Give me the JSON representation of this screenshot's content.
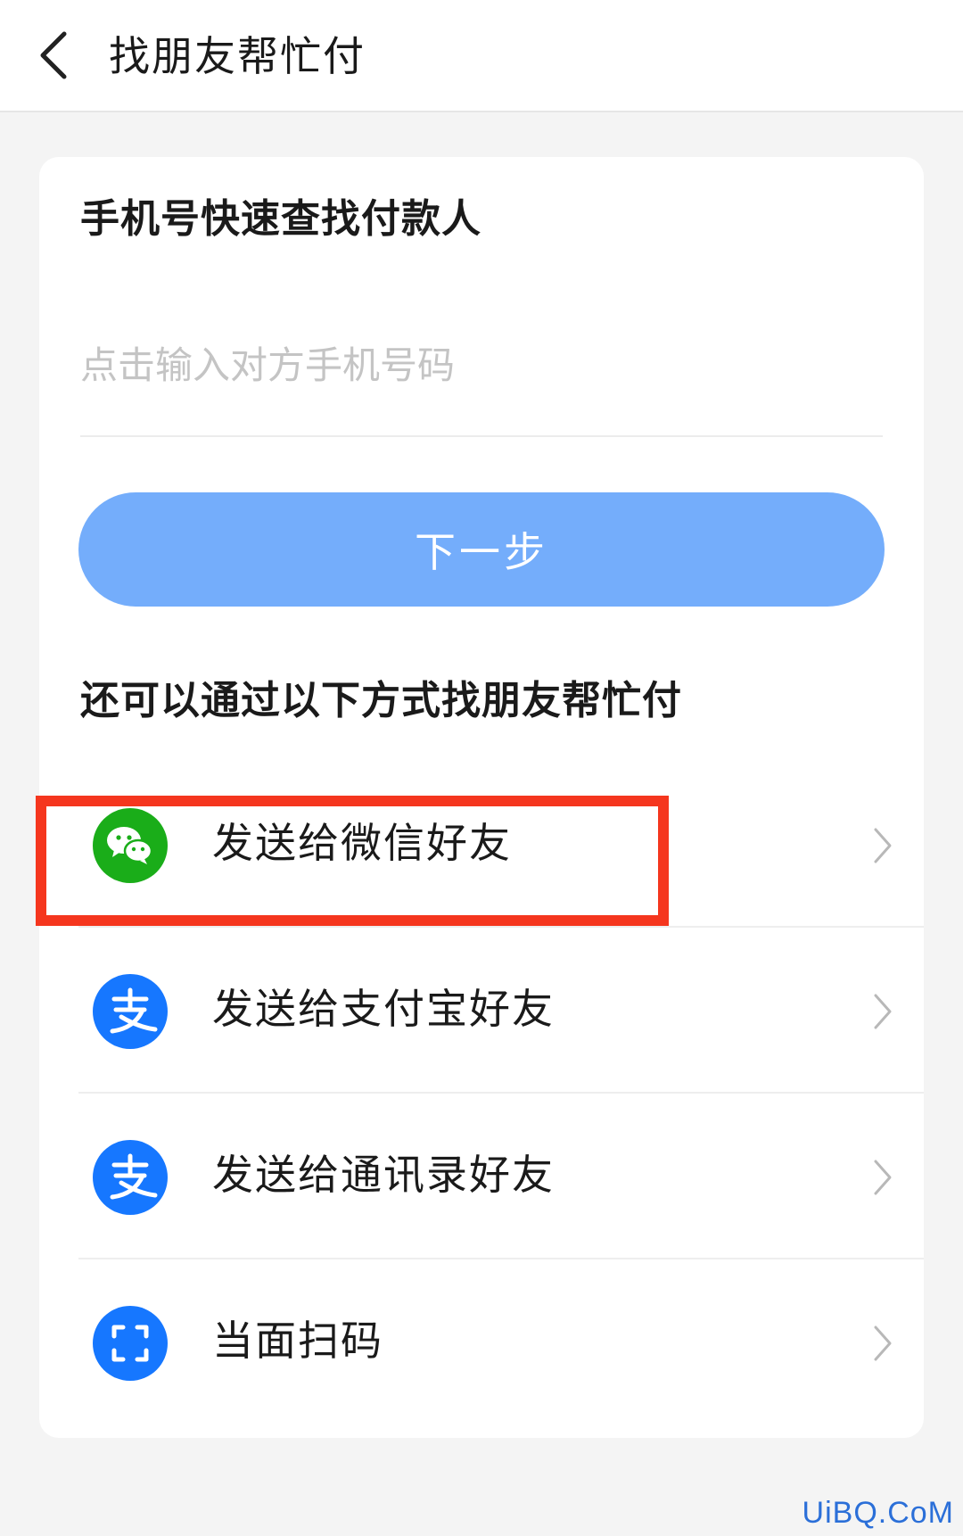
{
  "header": {
    "title": "找朋友帮忙付"
  },
  "phone_section": {
    "title": "手机号快速查找付款人",
    "input_placeholder": "点击输入对方手机号码",
    "input_value": "",
    "next_label": "下一步"
  },
  "alt_section": {
    "title": "还可以通过以下方式找朋友帮忙付",
    "options": [
      {
        "label": "发送给微信好友",
        "icon": "wechat-icon",
        "color": "#1aad19"
      },
      {
        "label": "发送给支付宝好友",
        "icon": "alipay-icon",
        "color": "#1677ff"
      },
      {
        "label": "发送给通讯录好友",
        "icon": "alipay-icon",
        "color": "#1677ff"
      },
      {
        "label": "当面扫码",
        "icon": "scan-icon",
        "color": "#1677ff"
      }
    ]
  },
  "highlight": {
    "color": "#f5361e"
  },
  "watermark": {
    "text": "UiBQ.CoM"
  },
  "colors": {
    "button": "#74adfb",
    "background": "#f4f4f4"
  }
}
